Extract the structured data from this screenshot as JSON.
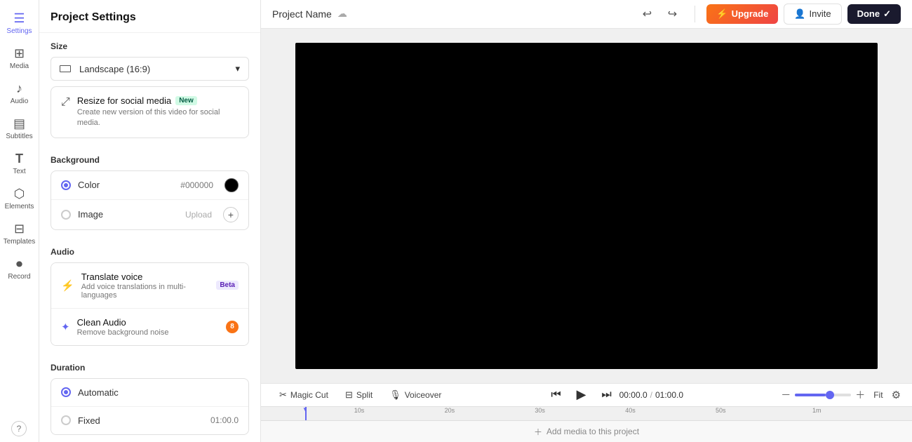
{
  "header": {
    "title": "Project Settings",
    "project_name": "Project Name"
  },
  "toolbar": {
    "upgrade_label": "Upgrade",
    "invite_label": "Invite",
    "done_label": "Done",
    "undo_icon": "↩",
    "redo_icon": "↪"
  },
  "sidebar": {
    "items": [
      {
        "id": "settings",
        "label": "Settings",
        "icon": "☰",
        "active": true
      },
      {
        "id": "media",
        "label": "Media",
        "icon": "⊞"
      },
      {
        "id": "audio",
        "label": "Audio",
        "icon": "♪"
      },
      {
        "id": "subtitles",
        "label": "Subtitles",
        "icon": "▤"
      },
      {
        "id": "text",
        "label": "Text",
        "icon": "T"
      },
      {
        "id": "elements",
        "label": "Elements",
        "icon": "⬡"
      },
      {
        "id": "templates",
        "label": "Templates",
        "icon": "⊟"
      },
      {
        "id": "record",
        "label": "Record",
        "icon": "⏺"
      }
    ]
  },
  "settings": {
    "size_section": "Size",
    "size_value": "Landscape (16:9)",
    "background_section": "Background",
    "color_label": "Color",
    "color_hex": "#000000",
    "image_label": "Image",
    "image_upload": "Upload",
    "audio_section": "Audio",
    "translate_voice_title": "Translate voice",
    "translate_voice_desc": "Add voice translations in multi-languages",
    "translate_badge": "Beta",
    "clean_audio_title": "Clean Audio",
    "clean_audio_desc": "Remove background noise",
    "clean_audio_badge": "8",
    "duration_section": "Duration",
    "automatic_label": "Automatic",
    "fixed_label": "Fixed",
    "fixed_value": "01:00.0",
    "resize_title": "Resize for social media",
    "resize_desc": "Create new version of this video for social media.",
    "resize_badge": "New"
  },
  "bottom_toolbar": {
    "magic_cut": "Magic Cut",
    "split": "Split",
    "voiceover": "Voiceover",
    "current_time": "00:00.0",
    "total_time": "01:00.0",
    "time_sep": "/",
    "fit_label": "Fit"
  },
  "timeline": {
    "add_media": "Add media to this project",
    "markers": [
      "10s",
      "20s",
      "30s",
      "40s",
      "50s",
      "1m"
    ]
  }
}
